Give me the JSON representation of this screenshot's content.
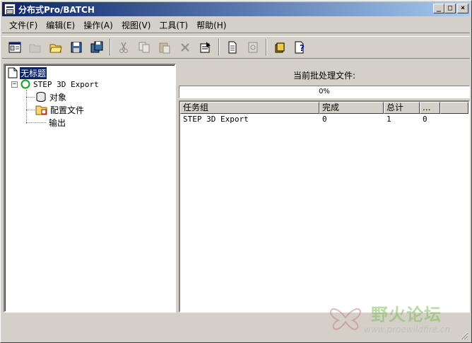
{
  "window": {
    "title": "分布式Pro/BATCH"
  },
  "title_buttons": {
    "minimize": "_",
    "maximize": "□",
    "close": "×"
  },
  "menu": [
    {
      "label": "文件(F)"
    },
    {
      "label": "编辑(E)"
    },
    {
      "label": "操作(A)"
    },
    {
      "label": "视图(V)"
    },
    {
      "label": "工具(T)"
    },
    {
      "label": "帮助(H)"
    }
  ],
  "toolbar": {
    "icons": [
      "new-database-icon",
      "open-folder-icon",
      "open-folder-yellow-icon",
      "save-icon",
      "save-all-icon",
      "cut-icon",
      "copy-icon",
      "paste-icon",
      "delete-icon",
      "properties-icon",
      "document-icon",
      "settings-icon",
      "books-icon",
      "help-icon"
    ]
  },
  "tree": {
    "root": "无标题",
    "task": "STEP 3D Export",
    "children": [
      "对象",
      "配置文件",
      "输出"
    ]
  },
  "batch": {
    "label": "当前批处理文件:",
    "progress_text": "0%",
    "progress": 0
  },
  "list": {
    "columns": [
      "任务组",
      "完成",
      "总计",
      "..."
    ],
    "rows": [
      [
        "STEP 3D Export",
        "0",
        "1",
        "0"
      ]
    ]
  },
  "watermark": {
    "title": "野火论坛",
    "url": "www.proewildfire.cn"
  },
  "colors": {
    "titlebar_start": "#0a246a",
    "titlebar_end": "#a6caf0",
    "face": "#d4d0c8",
    "selection": "#0a246a"
  }
}
